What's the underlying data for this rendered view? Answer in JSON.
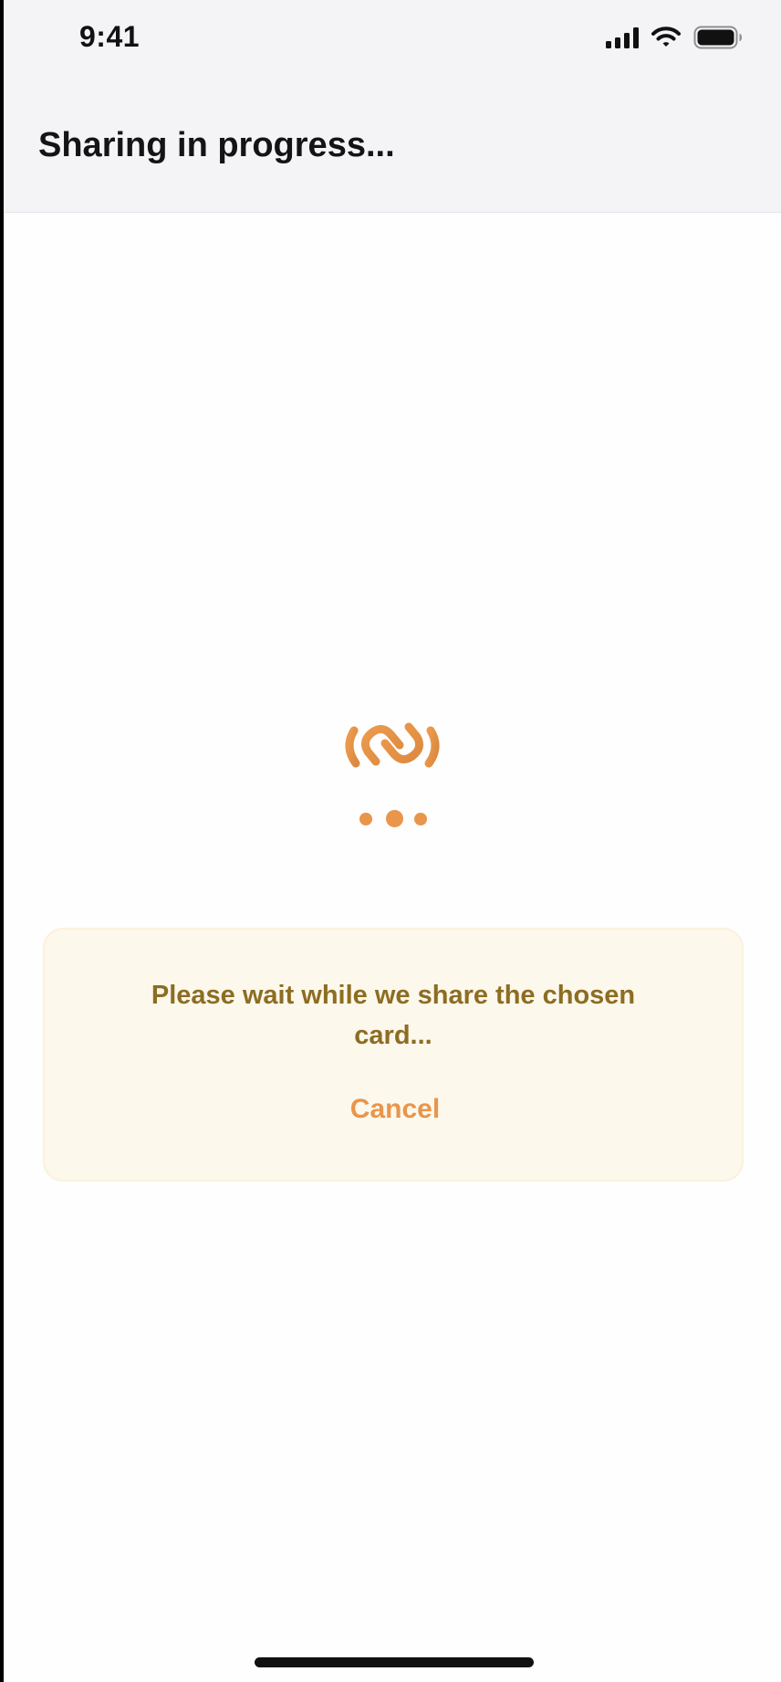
{
  "status_bar": {
    "time": "9:41",
    "icons": [
      "cellular-signal-icon",
      "wifi-icon",
      "battery-icon"
    ]
  },
  "header": {
    "title": "Sharing in progress..."
  },
  "loader": {
    "icon": "share-link-icon",
    "indicator": "loading-dots"
  },
  "card": {
    "message": "Please wait while we share the chosen card...",
    "cancel_label": "Cancel"
  },
  "colors": {
    "accent": "#e9954b",
    "card_background": "#fdf8ec",
    "card_text": "#8c6d22",
    "header_background": "#f4f3f6"
  }
}
